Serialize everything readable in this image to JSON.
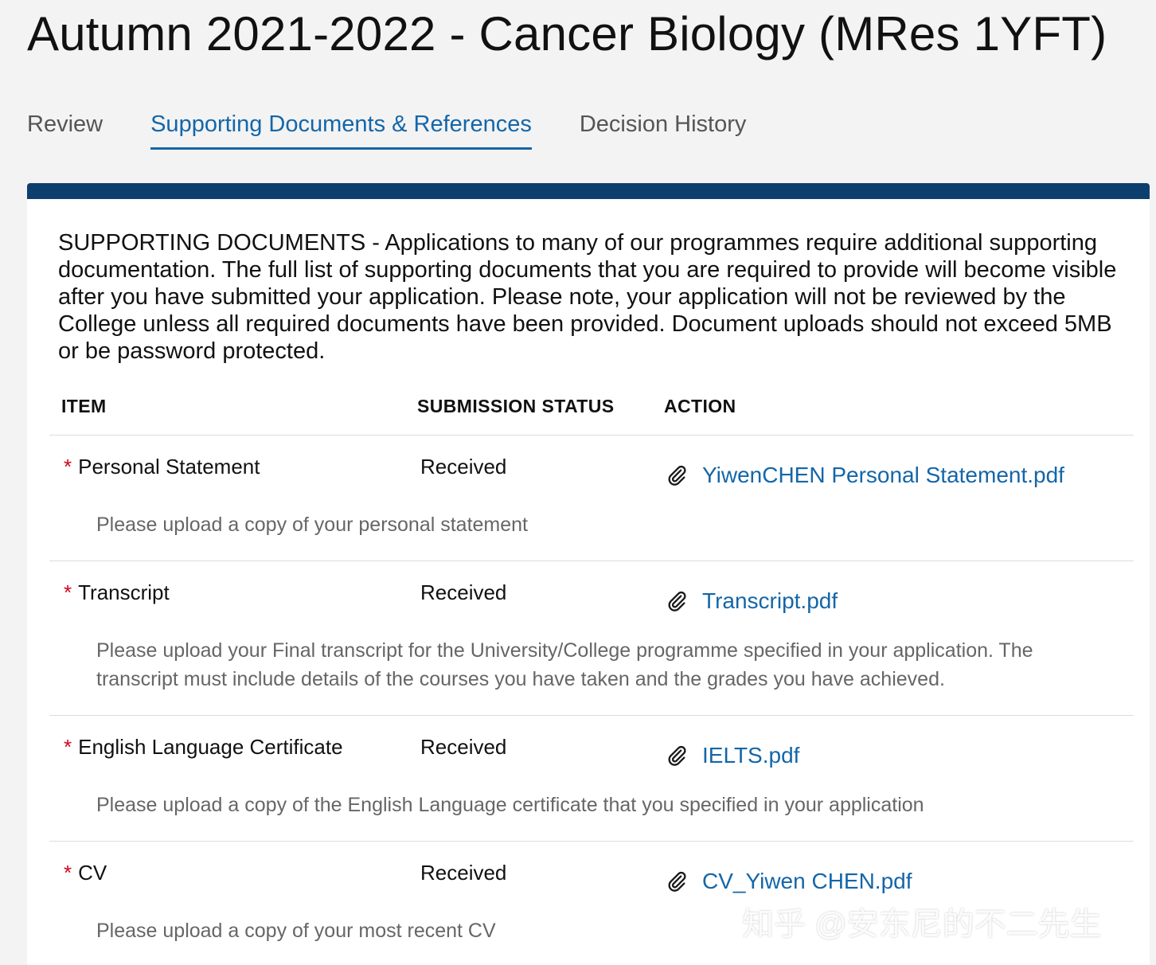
{
  "title": "Autumn 2021-2022 - Cancer Biology (MRes 1YFT)",
  "tabs": [
    {
      "label": "Review"
    },
    {
      "label": "Supporting Documents & References"
    },
    {
      "label": "Decision History"
    }
  ],
  "intro": "SUPPORTING DOCUMENTS - Applications to many of our programmes require additional supporting documentation. The full list of supporting documents that you are required to provide will become visible after you have submitted your application. Please note, your application will not be reviewed by the College unless all required documents have been provided. Document uploads should not exceed 5MB or be password protected.",
  "table": {
    "headers": {
      "item": "ITEM",
      "status": "SUBMISSION STATUS",
      "action": "ACTION"
    },
    "rows": [
      {
        "item": "Personal Statement",
        "status": "Received",
        "file": "YiwenCHEN Personal Statement.pdf",
        "description": "Please upload a copy of your personal statement"
      },
      {
        "item": "Transcript",
        "status": "Received",
        "file": "Transcript.pdf",
        "description": "Please upload your Final transcript for the University/College programme specified in your application. The transcript must include details of the courses you have taken and the grades you have achieved."
      },
      {
        "item": "English Language Certificate",
        "status": "Received",
        "file": "IELTS.pdf",
        "description": "Please upload a copy of the English Language certificate that you specified in your application"
      },
      {
        "item": "CV",
        "status": "Received",
        "file": "CV_Yiwen CHEN.pdf",
        "description": "Please upload a copy of your most recent CV"
      }
    ]
  },
  "required_marker": "*",
  "watermark": "知乎 @安东尼的不二先生",
  "colors": {
    "accent": "#1466a8",
    "card_bar": "#0d3f6e",
    "required": "#d0021b"
  },
  "icons": {
    "attachment": "paperclip-icon"
  }
}
